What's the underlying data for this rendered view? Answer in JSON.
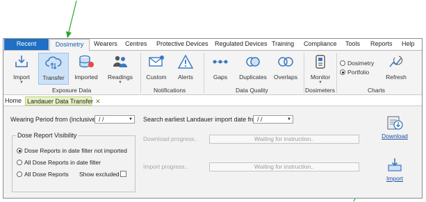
{
  "menu": {
    "recent": "Recent",
    "tabs": [
      "Dosimetry",
      "Wearers",
      "Centres",
      "Protective Devices",
      "Regulated Devices",
      "Training",
      "Compliance",
      "Tools",
      "Reports",
      "Help"
    ]
  },
  "ribbon": {
    "buttons": {
      "import": "Import",
      "transfer": "Transfer",
      "imported": "Imported",
      "readings": "Readings",
      "custom": "Custom",
      "alerts": "Alerts",
      "gaps": "Gaps",
      "duplicates": "Duplicates",
      "overlaps": "Overlaps",
      "monitor": "Monitor",
      "refresh": "Refresh"
    },
    "radios": {
      "dosimetry": "Dosimetry",
      "portfolio": "Portfolio",
      "selected": "Portfolio"
    },
    "groups": {
      "exposure": "Exposure Data",
      "notifications": "Notifications",
      "quality": "Data Quality",
      "dosimeters": "Dosimeters",
      "charts": "Charts"
    }
  },
  "doctabs": {
    "home": "Home",
    "current": "Landauer Data Transfer",
    "close": "✕"
  },
  "form": {
    "wearing_label": "Wearing Period from (inclusive):",
    "wearing_value": "/ /",
    "search_label": "Search earliest Landauer import date from:",
    "search_value": "/ /",
    "visibility_legend": "Dose Report Visibility",
    "opt1": "Dose Reports in date filter not imported",
    "opt2": "All Dose Reports in date filter",
    "opt3": "All Dose Reports",
    "show_excluded": "Show excluded",
    "download_progress": "Download progress..",
    "import_progress": "Import progress..",
    "waiting1": "Waiting for instruction..",
    "waiting2": "Waiting for instruction..",
    "download": "Download",
    "import": "Import"
  },
  "colors": {
    "accent": "#1f6fc4",
    "arrow": "#2aa52a",
    "active_tab_bg": "#e9f2c6"
  }
}
